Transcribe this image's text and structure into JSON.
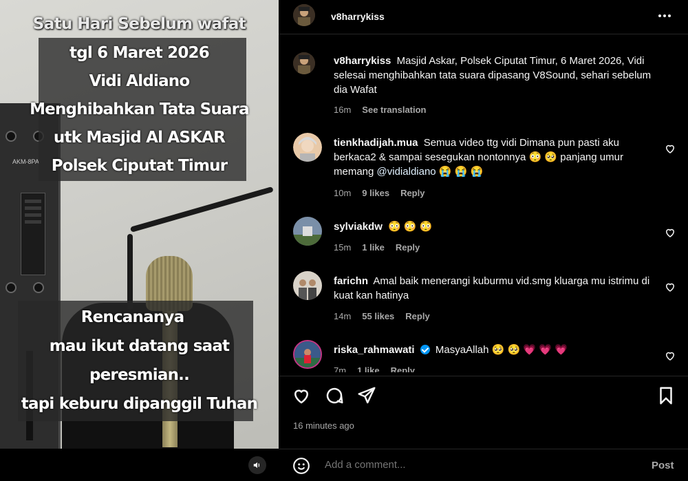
{
  "video": {
    "caption_title": "Satu Hari Sebelum wafat",
    "caption_top_lines": [
      "tgl 6 Maret 2026",
      "Vidi Aldiano",
      "Menghibahkan Tata Suara",
      "utk Masjid  Al ASKAR",
      "Polsek Ciputat Timur"
    ],
    "caption_bottom_lines": [
      "Rencananya",
      "mau ikut datang saat",
      "peresmian..",
      "tapi keburu dipanggil Tuhan"
    ],
    "mixer_label": "AKM-8PA",
    "audio_icon": "speaker-icon"
  },
  "header": {
    "username": "v8harrykiss",
    "more_icon": "more-options-icon"
  },
  "post_caption": {
    "username": "v8harrykiss",
    "text": "Masjid Askar, Polsek Ciputat Timur, 6 Maret 2026, Vidi selesai menghibahkan tata suara dipasang V8Sound, sehari sebelum dia Wafat",
    "time": "16m",
    "see_translation": "See translation"
  },
  "comments": [
    {
      "username": "tienkhadijah.mua",
      "text_a": "Semua video ttg vidi Dimana pun pasti aku berkaca2 & sampai sesegukan nontonnya",
      "emoji_a": "😳 🥺",
      "text_b": "panjang umur memang",
      "mention": "@vidialdiano",
      "emoji_b": "😭 😭 😭",
      "time": "10m",
      "likes": "9 likes",
      "reply": "Reply"
    },
    {
      "username": "sylviakdw",
      "emoji": "😳 😳 😳",
      "time": "15m",
      "likes": "1 like",
      "reply": "Reply"
    },
    {
      "username": "farichn",
      "text": "Amal baik menerangi kuburmu vid.smg kluarga mu istrimu di kuat kan hatinya",
      "time": "14m",
      "likes": "55 likes",
      "reply": "Reply"
    },
    {
      "username": "riska_rahmawati",
      "text": "MasyaAllah",
      "emoji": "🥺 🥺 💗 💗 💗",
      "time": "7m",
      "likes": "1 like",
      "reply": "Reply"
    }
  ],
  "actions": {
    "like_icon": "heart-icon",
    "comment_icon": "comment-icon",
    "share_icon": "share-icon",
    "save_icon": "bookmark-icon"
  },
  "timestamp": "16 minutes ago",
  "composer": {
    "placeholder": "Add a comment...",
    "post_label": "Post",
    "emoji_icon": "emoji-icon"
  },
  "colors": {
    "background": "#000000",
    "text_primary": "#f5f5f5",
    "text_secondary": "#a8a8a8",
    "verified": "#0095f6",
    "mention": "#e0f1ff"
  }
}
